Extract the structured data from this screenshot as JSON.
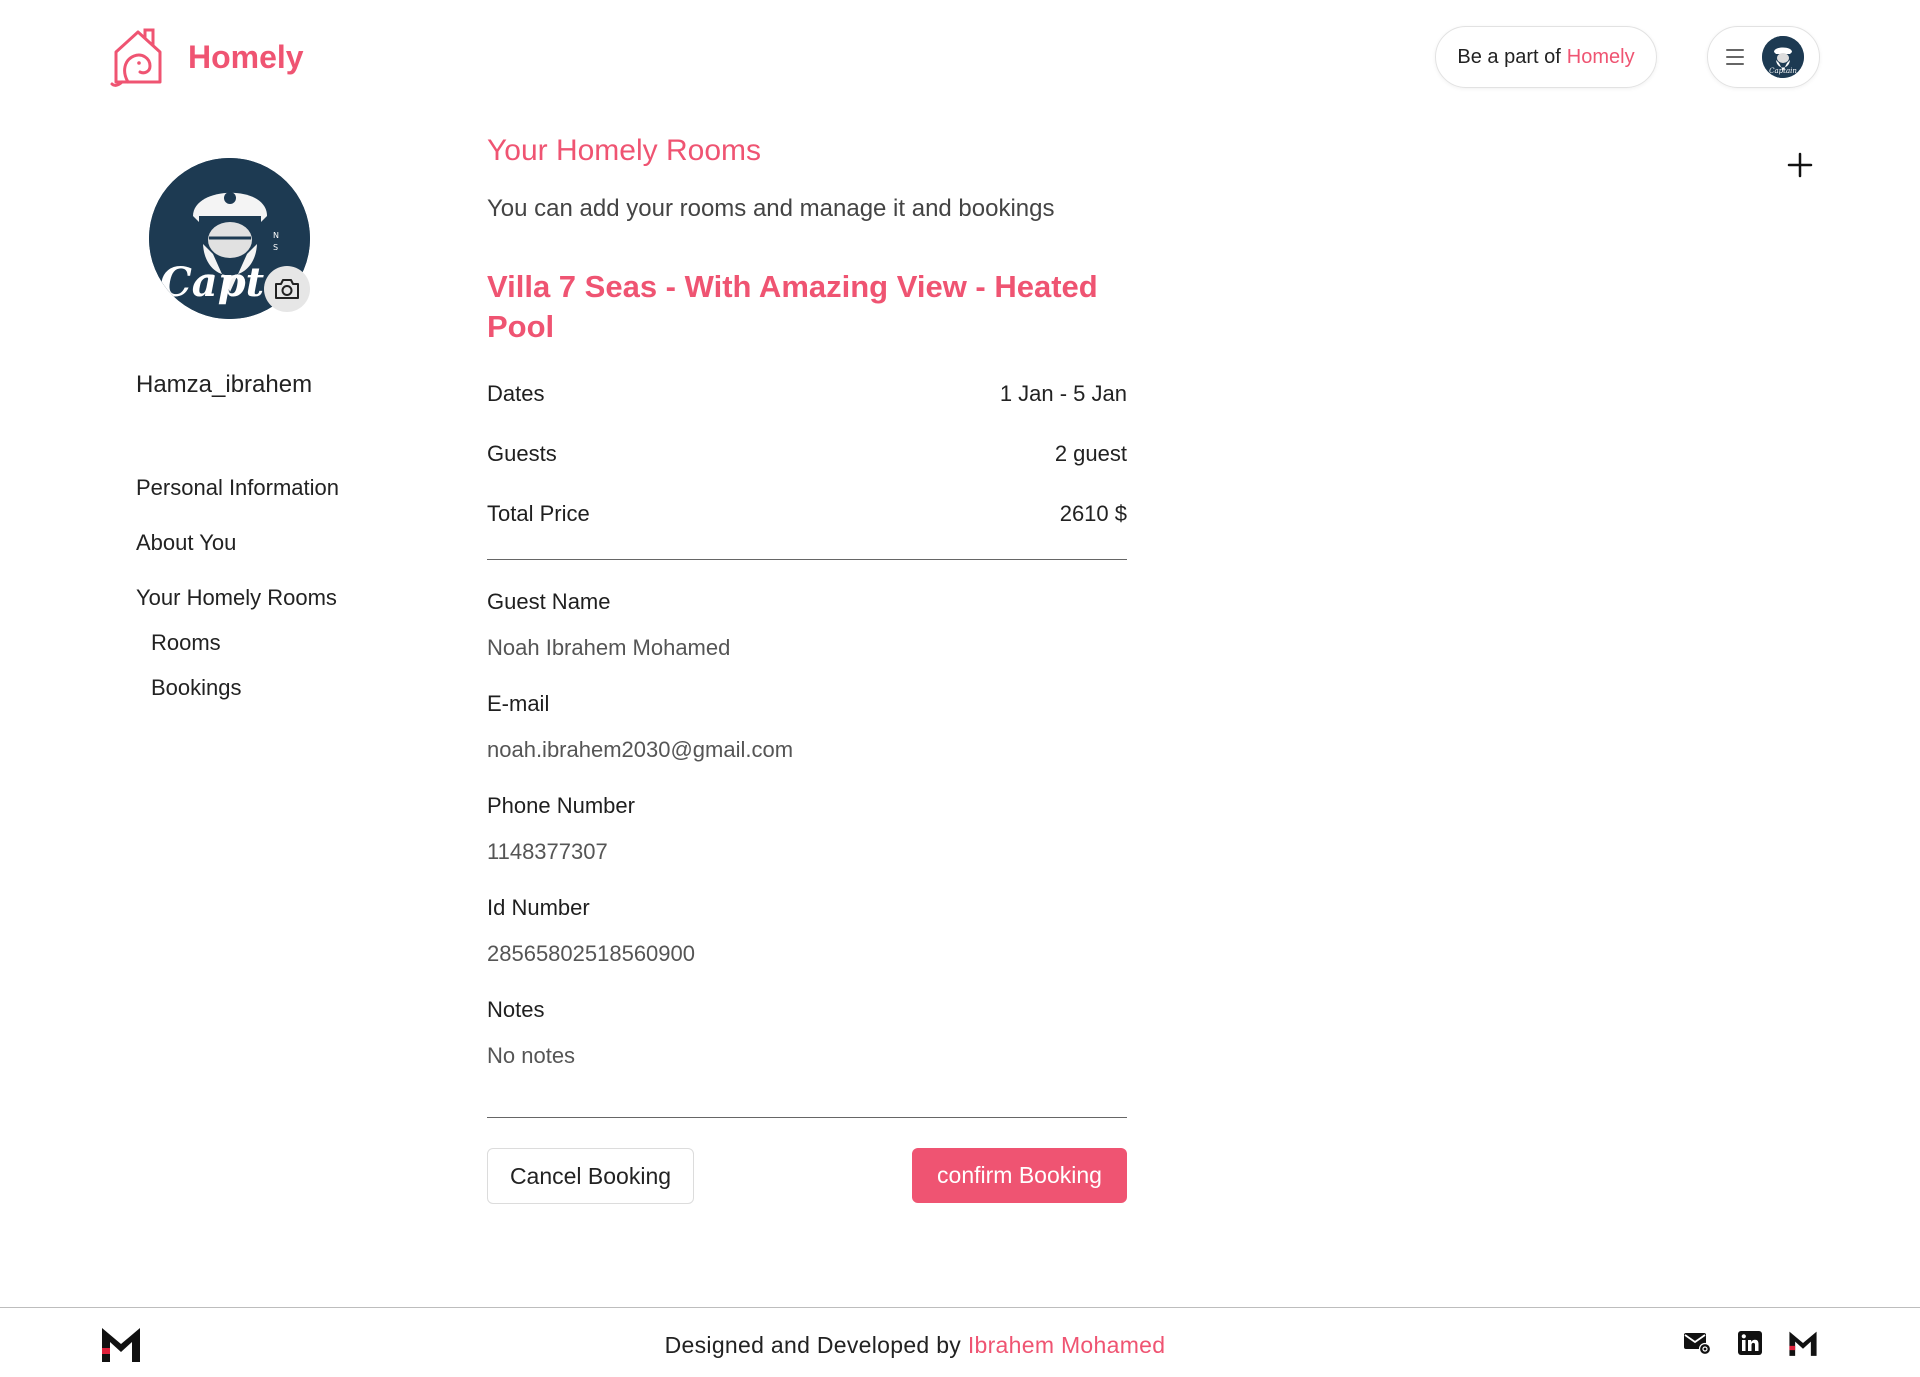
{
  "app": {
    "name": "Homely",
    "accent_color": "#ef5472"
  },
  "header": {
    "be_part_prefix": "Be a part of",
    "be_part_brand": "Homely",
    "menu_icon": "hamburger-icon",
    "avatar_icon": "user-avatar"
  },
  "sidebar": {
    "username": "Hamza_ibrahem",
    "camera_icon": "camera-icon",
    "nav": {
      "personal_information": "Personal Information",
      "about_you": "About You",
      "your_homely_rooms": "Your Homely Rooms",
      "rooms": "Rooms",
      "bookings": "Bookings"
    }
  },
  "main": {
    "title": "Your Homely Rooms",
    "subtitle": "You can add your rooms and manage it and bookings",
    "add_icon": "plus-icon",
    "booking": {
      "room_title": "Villa 7 Seas - With Amazing View - Heated Pool",
      "dates_label": "Dates",
      "dates_value": "1 Jan - 5 Jan",
      "guests_label": "Guests",
      "guests_value": "2 guest",
      "total_label": "Total Price",
      "total_value": "2610 $",
      "guest_name_label": "Guest Name",
      "guest_name_value": "Noah Ibrahem Mohamed",
      "email_label": "E-mail",
      "email_value": "noah.ibrahem2030@gmail.com",
      "phone_label": "Phone Number",
      "phone_value": "1148377307",
      "id_label": "Id Number",
      "id_value": "28565802518560900",
      "notes_label": "Notes",
      "notes_value": "No notes",
      "cancel_label": "Cancel Booking",
      "confirm_label": "confirm Booking"
    }
  },
  "footer": {
    "credit_prefix": "Designed and Developed by",
    "credit_name": "Ibrahem Mohamed",
    "icons": [
      "mail-icon",
      "linkedin-icon",
      "m-logo-icon"
    ]
  }
}
